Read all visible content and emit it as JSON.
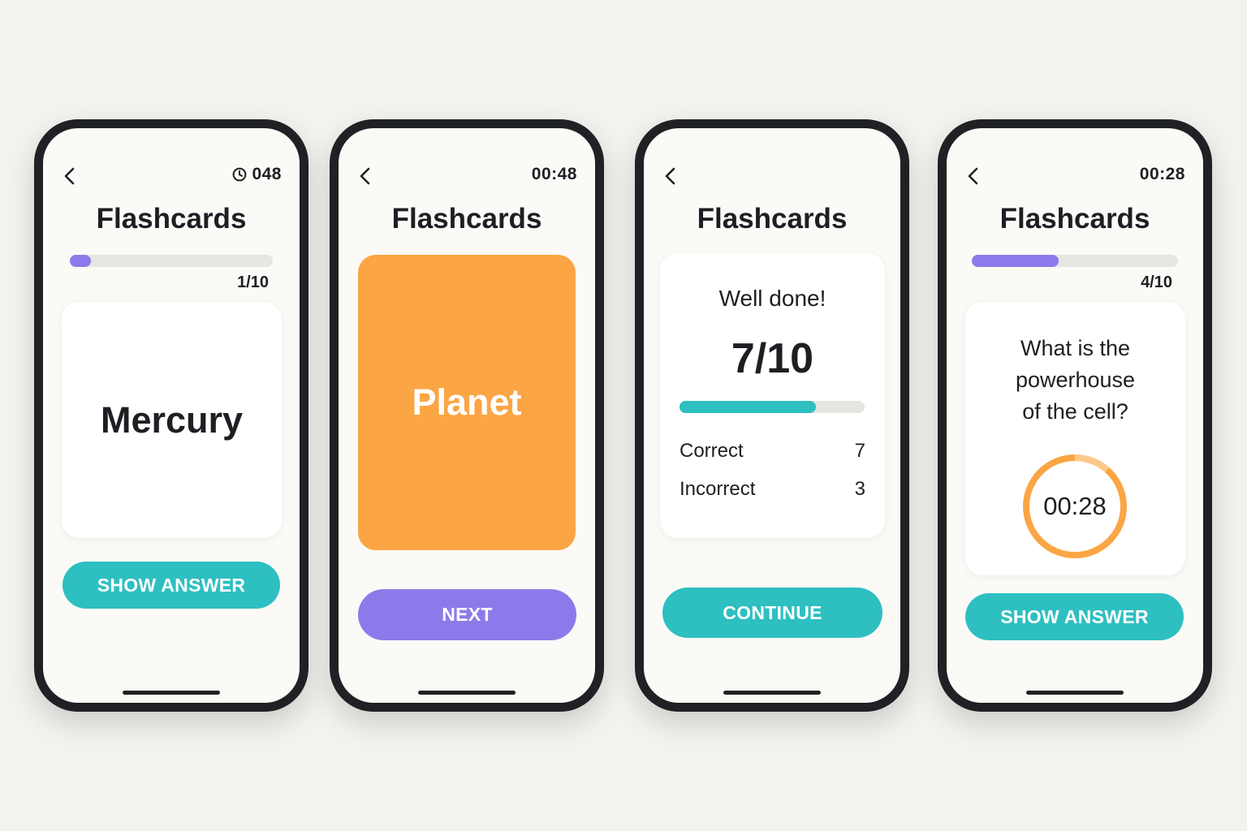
{
  "colors": {
    "purple": "#8b7bea",
    "teal": "#2ebfc1",
    "orange": "#fba544",
    "track": "#e6e5e1"
  },
  "screens": [
    {
      "timer": "048",
      "timer_icon": "clock-icon",
      "title": "Flashcards",
      "progress": 0.1,
      "count": "1/10",
      "card_text": "Mercury",
      "button": "SHOW ANSWER"
    },
    {
      "timer": "00:48",
      "title": "Flashcards",
      "card_text": "Planet",
      "button": "NEXT"
    },
    {
      "title": "Flashcards",
      "heading": "Well done!",
      "score": "7/10",
      "progress": 0.7,
      "stats": [
        {
          "label": "Correct",
          "value": "7"
        },
        {
          "label": "Incorrect",
          "value": "3"
        }
      ],
      "button": "CONTINUE"
    },
    {
      "timer": "00:28",
      "title": "Flashcards",
      "progress": 0.4,
      "count": "4/10",
      "question_lines": [
        "What is the",
        "powerhouse",
        "of the cell?"
      ],
      "countdown": "00:28",
      "button": "SHOW ANSWER"
    }
  ]
}
